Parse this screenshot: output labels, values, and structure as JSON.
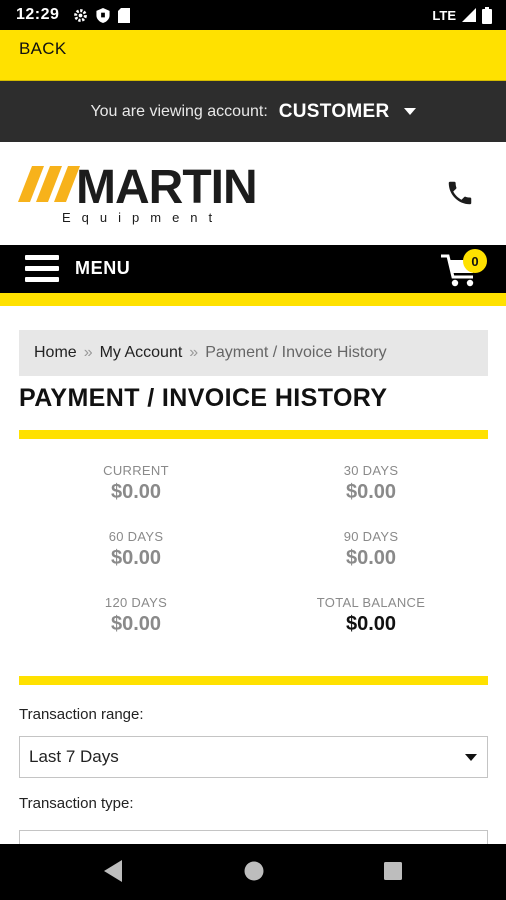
{
  "status_bar": {
    "time": "12:29",
    "network": "LTE"
  },
  "back_bar": {
    "label": "BACK"
  },
  "account_bar": {
    "label": "You are viewing account:",
    "account": "CUSTOMER"
  },
  "brand": {
    "name": "MARTIN",
    "tagline": "Equipment"
  },
  "nav": {
    "menu_label": "MENU",
    "cart_count": "0"
  },
  "breadcrumb": {
    "home": "Home",
    "separator": "»",
    "my_account": "My Account",
    "current": "Payment / Invoice History"
  },
  "page": {
    "title": "PAYMENT / INVOICE HISTORY"
  },
  "balances": {
    "current": {
      "label": "CURRENT",
      "value": "$0.00"
    },
    "days30": {
      "label": "30 DAYS",
      "value": "$0.00"
    },
    "days60": {
      "label": "60 DAYS",
      "value": "$0.00"
    },
    "days90": {
      "label": "90 DAYS",
      "value": "$0.00"
    },
    "days120": {
      "label": "120 DAYS",
      "value": "$0.00"
    },
    "total": {
      "label": "TOTAL BALANCE",
      "value": "$0.00"
    }
  },
  "filters": {
    "range_label": "Transaction range:",
    "range_value": "Last 7 Days",
    "type_label": "Transaction type:"
  },
  "colors": {
    "brand_yellow": "#ffe100",
    "dark_bar": "#2d2d2d",
    "logo_orange": "#f7b21b"
  }
}
